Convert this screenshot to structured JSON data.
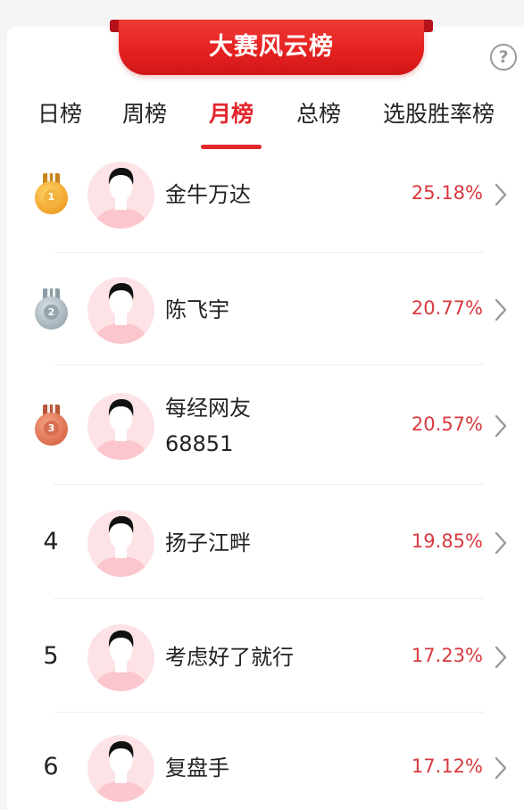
{
  "banner": {
    "title": "大赛风云榜"
  },
  "help": {
    "icon": "question-circle-icon",
    "glyph": "?"
  },
  "tabs": [
    {
      "label": "日榜",
      "active": false
    },
    {
      "label": "周榜",
      "active": false
    },
    {
      "label": "月榜",
      "active": true
    },
    {
      "label": "总榜",
      "active": false
    },
    {
      "label": "选股胜率榜",
      "active": false
    }
  ],
  "colors": {
    "accent": "#e5262d",
    "rate": "#d83a3f",
    "avatar_bg": "#fde3e6"
  },
  "rows": [
    {
      "rank": "1",
      "medal": "gold",
      "name_lines": [
        "金牛万达"
      ],
      "rate": "25.18%"
    },
    {
      "rank": "2",
      "medal": "silver",
      "name_lines": [
        "陈飞宇"
      ],
      "rate": "20.77%"
    },
    {
      "rank": "3",
      "medal": "bronze",
      "name_lines": [
        "每经网友",
        "68851"
      ],
      "rate": "20.57%"
    },
    {
      "rank": "4",
      "medal": null,
      "name_lines": [
        "扬子江畔"
      ],
      "rate": "19.85%"
    },
    {
      "rank": "5",
      "medal": null,
      "name_lines": [
        "考虑好了就行"
      ],
      "rate": "17.23%"
    },
    {
      "rank": "6",
      "medal": null,
      "name_lines": [
        "复盘手"
      ],
      "rate": "17.12%"
    }
  ]
}
